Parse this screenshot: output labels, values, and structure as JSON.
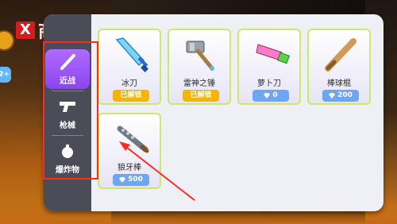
{
  "header": {
    "badge": "X",
    "title": "商店"
  },
  "hud": {
    "bubble_text": "2+"
  },
  "tabs": [
    {
      "label": "近战",
      "icon": "bat-icon",
      "active": true
    },
    {
      "label": "枪械",
      "icon": "gun-icon",
      "active": false
    },
    {
      "label": "爆炸物",
      "icon": "bomb-icon",
      "active": false
    }
  ],
  "items": [
    {
      "name": "冰刀",
      "icon": "ice-sword-icon",
      "status": "已解锁"
    },
    {
      "name": "雷神之锤",
      "icon": "thor-hammer-icon",
      "status": "已解锁"
    },
    {
      "name": "萝卜刀",
      "icon": "carrot-knife-icon",
      "price": "0"
    },
    {
      "name": "棒球棍",
      "icon": "baseball-bat-icon",
      "price": "200"
    },
    {
      "name": "狼牙棒",
      "icon": "spiked-club-icon",
      "price": "500"
    }
  ],
  "colors": {
    "accent_tab": "#8a46ee",
    "unlocked_pill": "#f4b400",
    "price_pill": "#6da6f4",
    "highlight": "#ff2a1e"
  }
}
